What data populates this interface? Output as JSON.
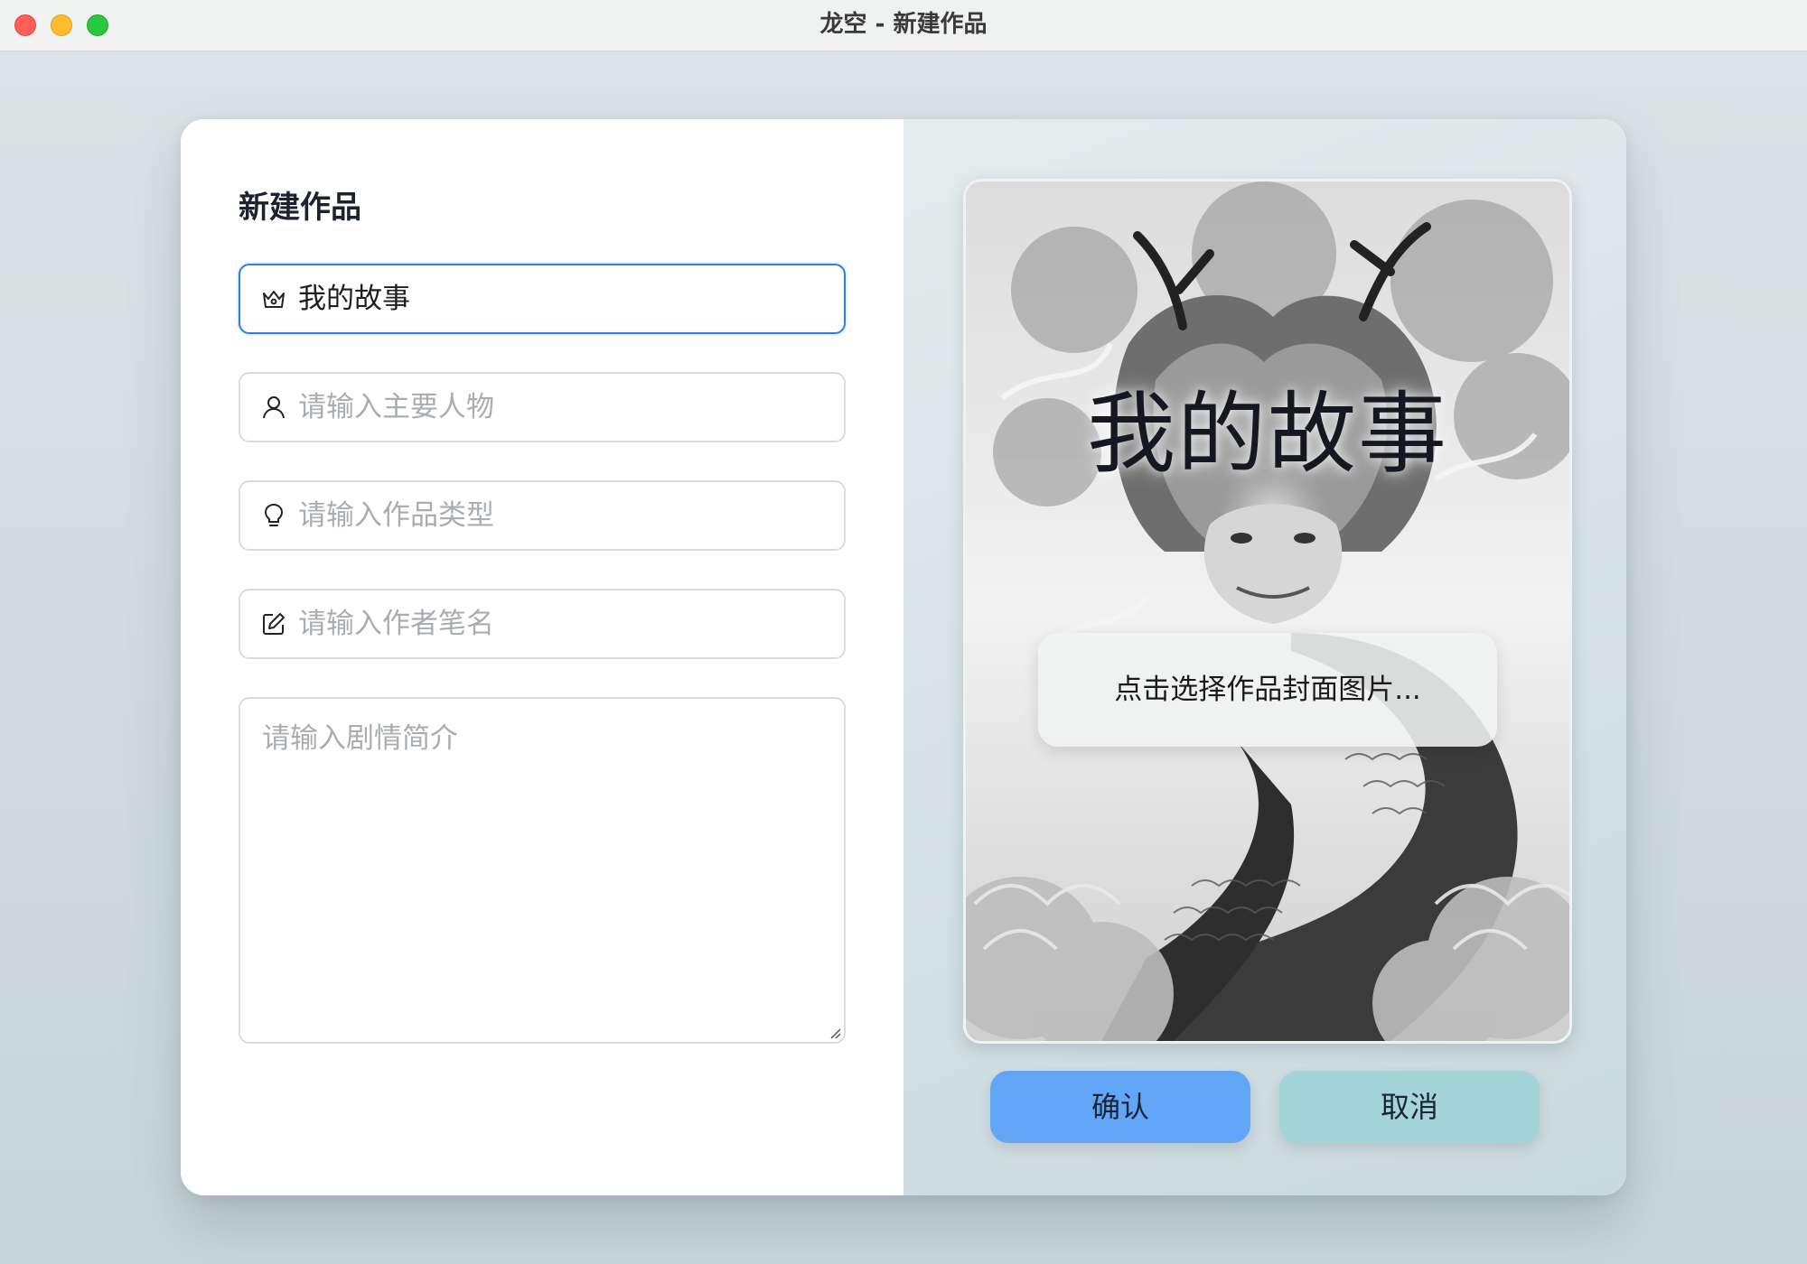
{
  "window": {
    "title": "龙空 - 新建作品"
  },
  "form": {
    "heading": "新建作品",
    "title_field": {
      "value": "我的故事",
      "icon": "crown-icon"
    },
    "character_field": {
      "placeholder": "请输入主要人物",
      "icon": "user-icon"
    },
    "genre_field": {
      "placeholder": "请输入作品类型",
      "icon": "lightbulb-icon"
    },
    "author_field": {
      "placeholder": "请输入作者笔名",
      "icon": "edit-icon"
    },
    "synopsis_field": {
      "placeholder": "请输入剧情简介"
    }
  },
  "cover": {
    "title": "我的故事",
    "pick_label": "点击选择作品封面图片..."
  },
  "actions": {
    "confirm_label": "确认",
    "cancel_label": "取消"
  },
  "colors": {
    "focus_border": "#2e7fe0",
    "confirm_bg": "#62a6f7",
    "cancel_bg": "#a3d4d8"
  }
}
